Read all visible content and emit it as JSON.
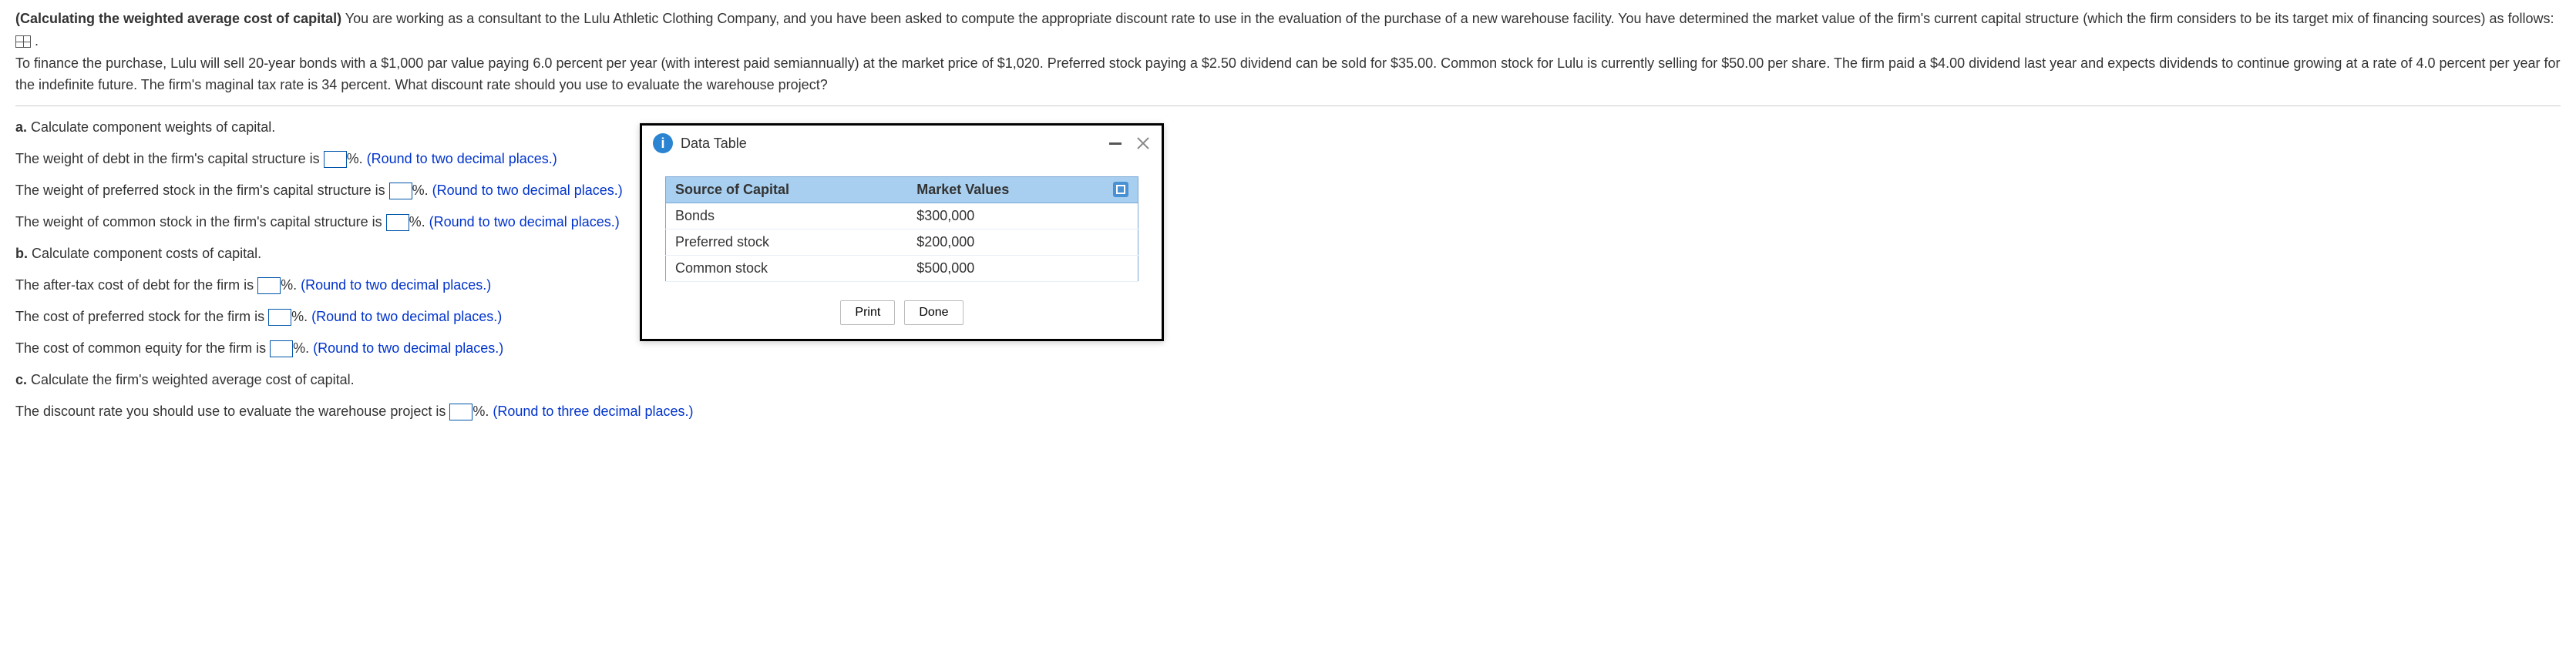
{
  "header": {
    "bold_intro": "(Calculating the weighted average cost of capital)",
    "paragraph1_part1": " You are working as a consultant to the Lulu Athletic Clothing Company, and you have been asked to compute the appropriate discount rate to use in the evaluation of the purchase of a new warehouse facility. You have determined the market value of the firm's current capital structure (which the firm considers to be its target mix of financing sources) as follows: ",
    "paragraph1_part2": " .",
    "paragraph2": "To finance the purchase, Lulu will sell 20-year bonds with a $1,000 par value paying 6.0 percent per year (with interest paid semiannually) at the market price of $1,020. Preferred stock paying a $2.50 dividend can be sold for $35.00. Common stock for Lulu is currently selling for $50.00 per share. The firm paid a $4.00 dividend last year and expects dividends to continue growing at a rate of 4.0 percent per year for the indefinite future. The firm's maginal tax rate is 34 percent. What discount rate should you use to evaluate the warehouse project?"
  },
  "parts": {
    "a": {
      "label": "a.",
      "title": "Calculate component weights of capital.",
      "q1_pre": "The weight of debt in the firm's capital structure is ",
      "q2_pre": "The weight of preferred stock in the firm's capital structure is ",
      "q3_pre": "The weight of common stock in the firm's capital structure is "
    },
    "b": {
      "label": "b.",
      "title": "Calculate component costs of capital.",
      "q1_pre": "The after-tax cost of debt for the firm is ",
      "q2_pre": "The cost of preferred stock for the firm is ",
      "q3_pre": "The cost of common equity for the firm is "
    },
    "c": {
      "label": "c.",
      "title": "Calculate the firm's weighted average cost of capital.",
      "q1_pre": "The discount rate you should use to evaluate the warehouse project is "
    }
  },
  "hints": {
    "two_dp": "(Round to two decimal places.)",
    "three_dp": "(Round to three decimal places.)"
  },
  "pct": "%. ",
  "popup": {
    "title": "Data Table",
    "columns": {
      "c1": "Source of Capital",
      "c2": "Market Values"
    },
    "rows": [
      {
        "source": "Bonds",
        "value": "$300,000"
      },
      {
        "source": "Preferred stock",
        "value": "$200,000"
      },
      {
        "source": "Common stock",
        "value": "$500,000"
      }
    ],
    "print": "Print",
    "done": "Done"
  }
}
